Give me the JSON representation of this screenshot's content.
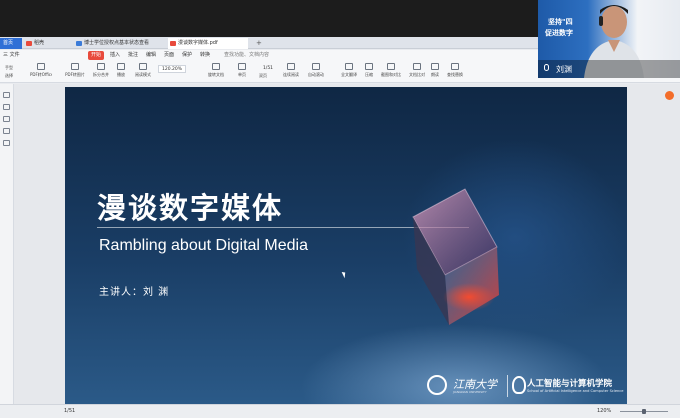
{
  "tabs": [
    {
      "label": "首页"
    },
    {
      "label": "稻壳"
    },
    {
      "label": "博士学位授权点基本状态查看"
    },
    {
      "label": "漫谈数字媒体.pdf"
    },
    {
      "label": "+"
    }
  ],
  "menu": {
    "file": "三 文件",
    "items": [
      "开始",
      "插入",
      "批注",
      "编辑",
      "页面",
      "保护",
      "转换"
    ],
    "search": "查找功能、文档内容"
  },
  "ribbon": {
    "tools": [
      "PDF转Office",
      "PDF转图片",
      "拆分合并",
      "播放",
      "阅读模式",
      "旋转文档",
      "单页",
      "双页",
      "连续阅读",
      "自动滚动",
      "全文翻译",
      "压缩",
      "截图和对比",
      "文档比对",
      "朗读",
      "查找替换"
    ],
    "left_tools": [
      "手型",
      "选择"
    ],
    "zoom": "120.20%",
    "page": "1/51"
  },
  "slide": {
    "title": "漫谈数字媒体",
    "subtitle": "Rambling about Digital Media",
    "speaker": "主讲人：刘  渊",
    "university_cn": "江南大学",
    "university_en": "JIANGNAN UNIVERSITY",
    "school_cn": "人工智能与计算机学院",
    "school_en": "School of Artificial Intelligence and Computer Science"
  },
  "statusbar": {
    "page": "1/51",
    "zoom": "120%"
  },
  "webcam": {
    "line1": "坚持\"四",
    "line2": "促进数字",
    "name": "刘渊"
  },
  "colors": {
    "accent": "#e84a3c",
    "home_tab": "#2f6fd6",
    "slide_bg": "#1a3e66"
  }
}
